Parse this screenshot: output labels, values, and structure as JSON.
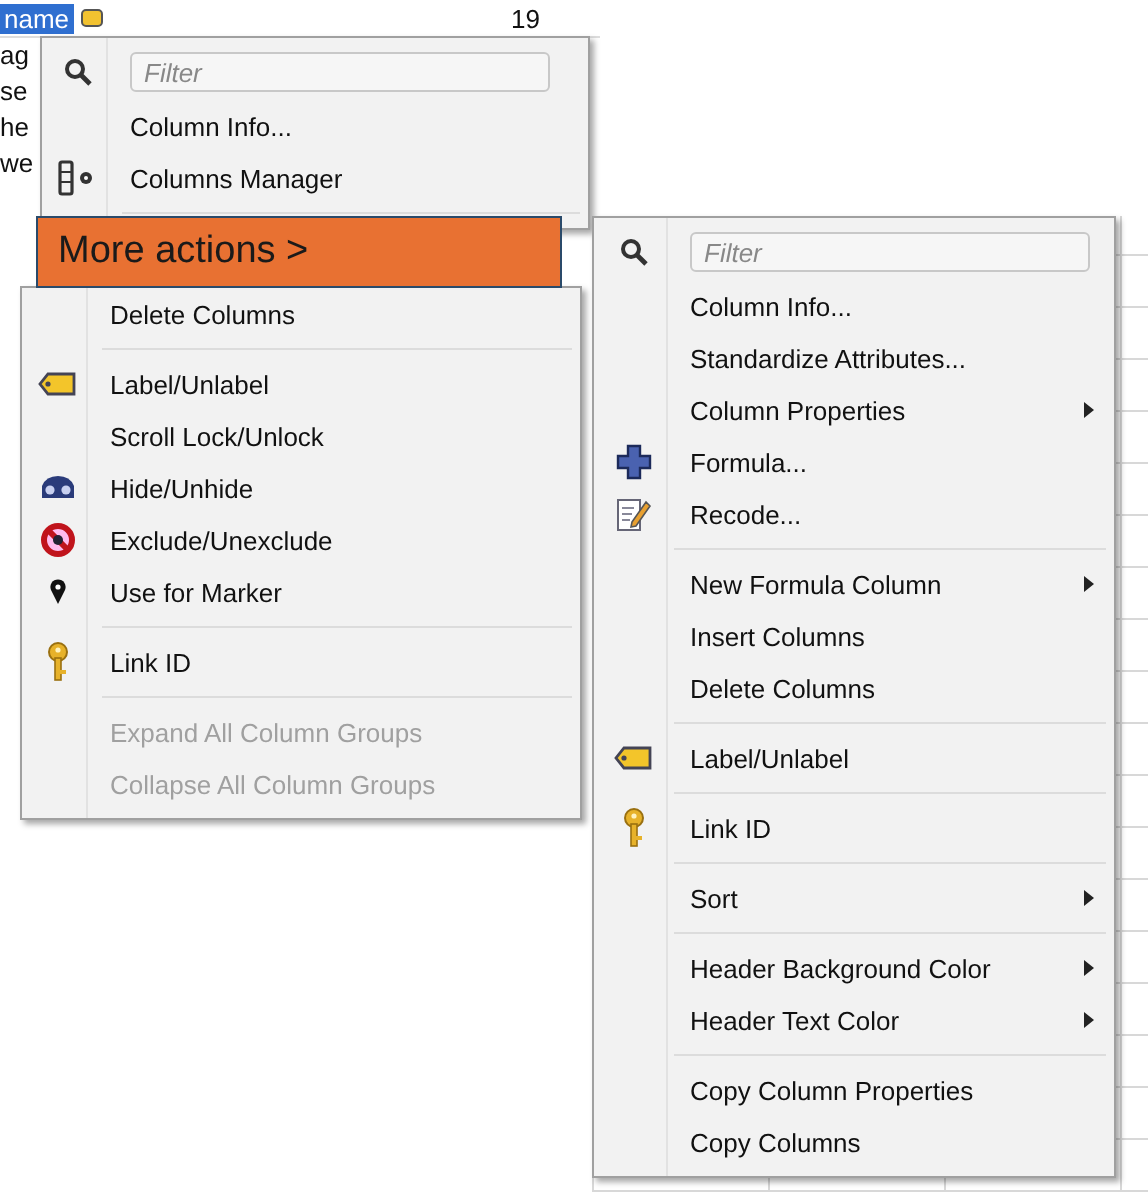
{
  "table_fragment": {
    "header": "name",
    "count": "19",
    "rows": [
      "ag",
      "se",
      "he",
      "we"
    ]
  },
  "left_menu_top": {
    "filter": {
      "placeholder": "Filter"
    },
    "items": [
      {
        "kind": "item",
        "label": "Column Info...",
        "disabled": false,
        "submenu": false
      },
      {
        "kind": "item",
        "label": "Columns Manager",
        "disabled": false,
        "submenu": false
      },
      {
        "kind": "separator"
      }
    ]
  },
  "more_actions_banner": {
    "label": "More actions >"
  },
  "left_menu_bottom": {
    "items": [
      {
        "kind": "item",
        "label": "Delete Columns",
        "disabled": false,
        "submenu": false
      },
      {
        "kind": "separator"
      },
      {
        "kind": "item",
        "label": "Label/Unlabel",
        "disabled": false,
        "submenu": false
      },
      {
        "kind": "item",
        "label": "Scroll Lock/Unlock",
        "disabled": false,
        "submenu": false
      },
      {
        "kind": "item",
        "label": "Hide/Unhide",
        "disabled": false,
        "submenu": false
      },
      {
        "kind": "item",
        "label": "Exclude/Unexclude",
        "disabled": false,
        "submenu": false
      },
      {
        "kind": "item",
        "label": "Use for Marker",
        "disabled": false,
        "submenu": false
      },
      {
        "kind": "separator"
      },
      {
        "kind": "item",
        "label": "Link ID",
        "disabled": false,
        "submenu": false
      },
      {
        "kind": "separator"
      },
      {
        "kind": "item",
        "label": "Expand All Column Groups",
        "disabled": true,
        "submenu": false
      },
      {
        "kind": "item",
        "label": "Collapse All Column Groups",
        "disabled": true,
        "submenu": false
      }
    ]
  },
  "right_menu": {
    "filter": {
      "placeholder": "Filter"
    },
    "items": [
      {
        "kind": "item",
        "label": "Column Info...",
        "disabled": false,
        "submenu": false
      },
      {
        "kind": "item",
        "label": "Standardize Attributes...",
        "disabled": false,
        "submenu": false
      },
      {
        "kind": "item",
        "label": "Column Properties",
        "disabled": false,
        "submenu": true
      },
      {
        "kind": "item",
        "label": "Formula...",
        "disabled": false,
        "submenu": false
      },
      {
        "kind": "item",
        "label": "Recode...",
        "disabled": false,
        "submenu": false
      },
      {
        "kind": "separator"
      },
      {
        "kind": "item",
        "label": "New Formula Column",
        "disabled": false,
        "submenu": true
      },
      {
        "kind": "item",
        "label": "Insert Columns",
        "disabled": false,
        "submenu": false
      },
      {
        "kind": "item",
        "label": "Delete Columns",
        "disabled": false,
        "submenu": false
      },
      {
        "kind": "separator"
      },
      {
        "kind": "item",
        "label": "Label/Unlabel",
        "disabled": false,
        "submenu": false
      },
      {
        "kind": "separator"
      },
      {
        "kind": "item",
        "label": "Link ID",
        "disabled": false,
        "submenu": false
      },
      {
        "kind": "separator"
      },
      {
        "kind": "item",
        "label": "Sort",
        "disabled": false,
        "submenu": true
      },
      {
        "kind": "separator"
      },
      {
        "kind": "item",
        "label": "Header Background Color",
        "disabled": false,
        "submenu": true
      },
      {
        "kind": "item",
        "label": "Header Text Color",
        "disabled": false,
        "submenu": true
      },
      {
        "kind": "separator"
      },
      {
        "kind": "item",
        "label": "Copy Column Properties",
        "disabled": false,
        "submenu": false
      },
      {
        "kind": "item",
        "label": "Copy Columns",
        "disabled": false,
        "submenu": false
      }
    ]
  }
}
